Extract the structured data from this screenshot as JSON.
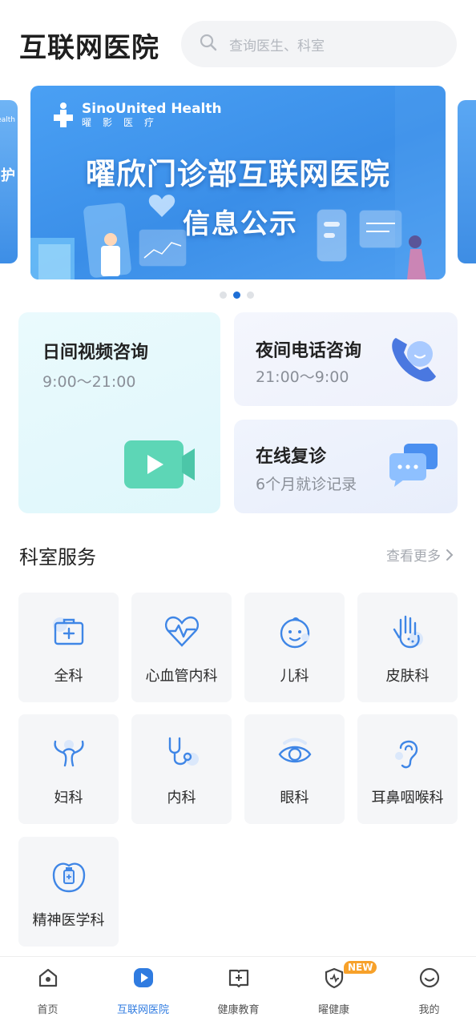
{
  "header": {
    "title": "互联网医院",
    "search_placeholder": "查询医生、科室"
  },
  "banner": {
    "brand_en": "SinoUnited Health",
    "brand_cn": "曜影医疗",
    "title": "曜欣门诊部互联网医院",
    "subtitle": "信息公示",
    "peek_left_text": "ealth",
    "peek_left_char": "护",
    "dots_total": 3,
    "active_dot": 2
  },
  "consult": {
    "day": {
      "title": "日间视频咨询",
      "hours": "9:00～21:00"
    },
    "night": {
      "title": "夜间电话咨询",
      "hours": "21:00～9:00"
    },
    "revisit": {
      "title": "在线复诊",
      "desc": "6个月就诊记录"
    }
  },
  "departments": {
    "title": "科室服务",
    "more": "查看更多",
    "items": [
      {
        "label": "全科",
        "icon": "medical-kit-icon"
      },
      {
        "label": "心血管内科",
        "icon": "heartbeat-icon"
      },
      {
        "label": "儿科",
        "icon": "baby-face-icon"
      },
      {
        "label": "皮肤科",
        "icon": "hand-skin-icon"
      },
      {
        "label": "妇科",
        "icon": "uterus-icon"
      },
      {
        "label": "内科",
        "icon": "stethoscope-icon"
      },
      {
        "label": "眼科",
        "icon": "eye-icon"
      },
      {
        "label": "耳鼻咽喉科",
        "icon": "ear-icon"
      },
      {
        "label": "精神医学科",
        "icon": "mind-pill-icon"
      }
    ]
  },
  "tabbar": {
    "items": [
      {
        "label": "首页",
        "icon": "home-icon",
        "active": false
      },
      {
        "label": "互联网医院",
        "icon": "play-hospital-icon",
        "active": true
      },
      {
        "label": "健康教育",
        "icon": "book-icon",
        "active": false
      },
      {
        "label": "曜健康",
        "icon": "shield-icon",
        "active": false,
        "badge": "NEW"
      },
      {
        "label": "我的",
        "icon": "smile-icon",
        "active": false
      }
    ]
  },
  "colors": {
    "accent": "#2f7be0",
    "icon_blue": "#3f86e6",
    "badge": "#f7a12a"
  }
}
